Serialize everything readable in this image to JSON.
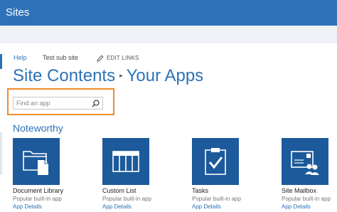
{
  "suite_bar": {
    "title": "Sites"
  },
  "top_nav": {
    "items": [
      "Help",
      "Test sub site"
    ],
    "edit_links": "EDIT LINKS"
  },
  "breadcrumb": {
    "parent": "Site Contents",
    "separator": "▸",
    "current": "Your Apps"
  },
  "search": {
    "placeholder": "Find an app",
    "value": ""
  },
  "section": {
    "title": "Noteworthy"
  },
  "apps": [
    {
      "name": "Document Library",
      "subtitle": "Popular built-in app",
      "details": "App Details",
      "icon": "document-library-icon"
    },
    {
      "name": "Custom List",
      "subtitle": "Popular built-in app",
      "details": "App Details",
      "icon": "custom-list-icon"
    },
    {
      "name": "Tasks",
      "subtitle": "Popular built-in app",
      "details": "App Details",
      "icon": "tasks-icon"
    },
    {
      "name": "Site Mailbox",
      "subtitle": "Popular built-in app",
      "details": "App Details",
      "icon": "site-mailbox-icon"
    }
  ],
  "colors": {
    "accent": "#2d72b7",
    "tile": "#1c5a9b",
    "highlight": "#f28b2b",
    "subbar": "#eef1f6"
  }
}
